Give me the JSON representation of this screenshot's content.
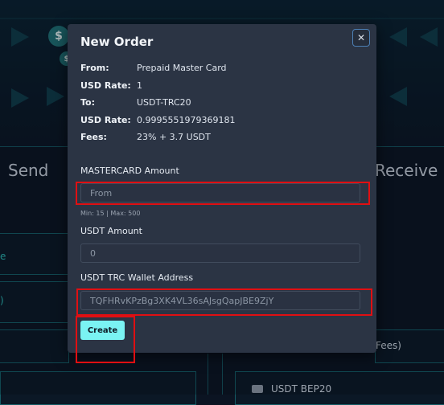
{
  "background": {
    "send_title": "Send",
    "receive_title": "Receive",
    "left_peek_1": "e",
    "left_peek_2": ")",
    "receive_fees_peek": "Fees)",
    "receive_item": "USDT BEP20"
  },
  "modal": {
    "title": "New Order",
    "close_icon": "✕",
    "info": [
      {
        "key": "From:",
        "value": "Prepaid Master Card"
      },
      {
        "key": "USD Rate:",
        "value": "1"
      },
      {
        "key": "To:",
        "value": "USDT-TRC20"
      },
      {
        "key": "USD Rate:",
        "value": "0.9995551979369181"
      },
      {
        "key": "Fees:",
        "value": "23% + 3.7 USDT"
      }
    ],
    "amount_label": "MASTERCARD Amount",
    "amount_placeholder": "From",
    "amount_hint": "Min: 15 | Max: 500",
    "usdt_label": "USDT Amount",
    "usdt_value": "0",
    "wallet_label": "USDT TRC Wallet Address",
    "wallet_value": "TQFHRvKPzBg3XK4VL36sAJsgQapJBE9ZjY",
    "create_label": "Create"
  },
  "colors": {
    "accent": "#7af3f3",
    "highlight": "#e00f12",
    "modal_bg": "#2b3444"
  }
}
